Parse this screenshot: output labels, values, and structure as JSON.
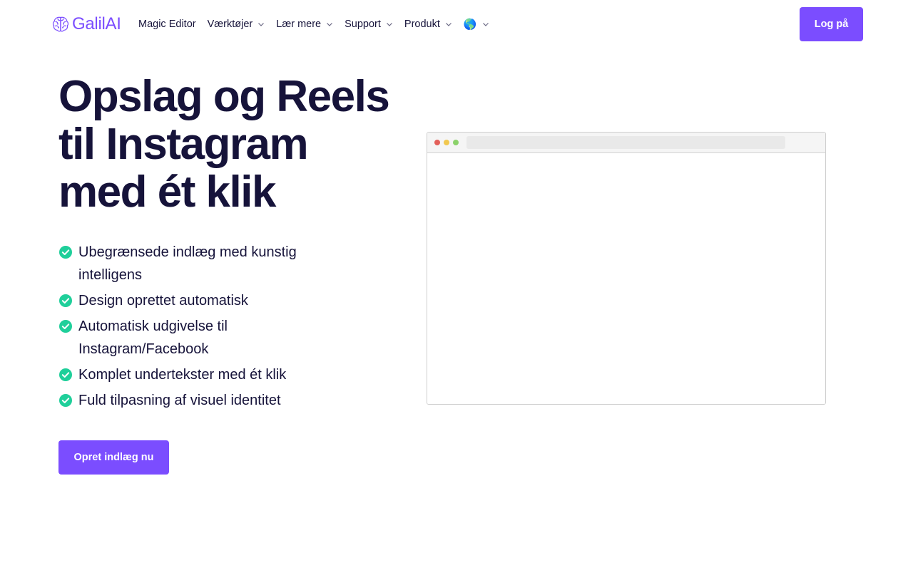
{
  "brand": {
    "name": "GalilAI",
    "color": "#7b4dff"
  },
  "nav": {
    "items": [
      {
        "label": "Magic Editor",
        "has_dropdown": false
      },
      {
        "label": "Værktøjer",
        "has_dropdown": true
      },
      {
        "label": "Lær mere",
        "has_dropdown": true
      },
      {
        "label": "Support",
        "has_dropdown": true
      },
      {
        "label": "Produkt",
        "has_dropdown": true
      }
    ],
    "language_icon": "🌎",
    "login_label": "Log på"
  },
  "hero": {
    "title": "Opslag og Reels til Instagram med ét klik",
    "features": [
      "Ubegrænsede indlæg med kunstig intelligens",
      "Design oprettet automatisk",
      "Automatisk udgivelse til Instagram/Facebook",
      "Komplet undertekster med ét klik",
      "Fuld tilpasning af visuel identitet"
    ],
    "cta_label": "Opret indlæg nu"
  },
  "colors": {
    "accent": "#7b4dff",
    "text": "#16133a",
    "check": "#1fcf9a"
  },
  "icons": {
    "feature": "check-circle-icon",
    "dropdown": "chevron-down-icon",
    "language": "globe-icon"
  }
}
